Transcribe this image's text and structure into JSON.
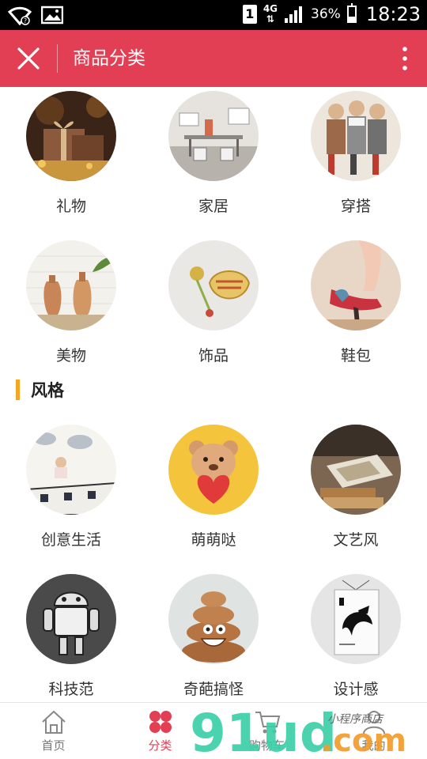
{
  "statusbar": {
    "sim_slot": "1",
    "network": "4G",
    "battery": "36%",
    "time": "18:23"
  },
  "header": {
    "title": "商品分类",
    "close_icon": "close-icon",
    "more_icon": "more-vertical-icon"
  },
  "colors": {
    "accent": "#e23f55",
    "section_bar": "#f5a623"
  },
  "categories": [
    {
      "label": "礼物"
    },
    {
      "label": "家居"
    },
    {
      "label": "穿搭"
    },
    {
      "label": "美物"
    },
    {
      "label": "饰品"
    },
    {
      "label": "鞋包"
    }
  ],
  "style_section": {
    "title": "风格",
    "items": [
      {
        "label": "创意生活"
      },
      {
        "label": "萌萌哒"
      },
      {
        "label": "文艺风"
      },
      {
        "label": "科技范"
      },
      {
        "label": "奇葩搞怪"
      },
      {
        "label": "设计感"
      }
    ]
  },
  "bottom_nav": {
    "items": [
      {
        "label": "首页",
        "icon": "home-icon"
      },
      {
        "label": "分类",
        "icon": "category-icon"
      },
      {
        "label": "购物车",
        "icon": "cart-icon"
      },
      {
        "label": "我的",
        "icon": "user-icon"
      }
    ],
    "active_index": 1
  },
  "watermark": {
    "brand": "91ud",
    "tld": ".com",
    "tagline": "小程序商店"
  }
}
